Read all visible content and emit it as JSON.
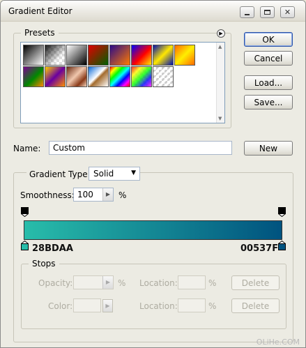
{
  "window": {
    "title": "Gradient Editor"
  },
  "presets": {
    "label": "Presets",
    "swatches": [
      "black-white",
      "transparent-black",
      "black-white-2",
      "red-green",
      "violet-orange",
      "blue-red-yellow",
      "blue-yellow-blue",
      "orange-yellow-orange",
      "violet-green-orange",
      "yellow-violet-orange",
      "copper",
      "chrome",
      "spectrum",
      "transparent-rainbow",
      "transparent-stripes"
    ]
  },
  "buttons": {
    "ok": "OK",
    "cancel": "Cancel",
    "load": "Load...",
    "save": "Save...",
    "new": "New"
  },
  "name_field": {
    "label": "Name:",
    "value": "Custom"
  },
  "gradient": {
    "type_label": "Gradient Type:",
    "type_value": "Solid",
    "smoothness_label": "Smoothness:",
    "smoothness_value": "100",
    "smoothness_unit": "%",
    "left_color_hex": "28BDAA",
    "right_color_hex": "00537F",
    "left_color": "#28BDAA",
    "right_color": "#00537F"
  },
  "stops": {
    "label": "Stops",
    "opacity_label": "Opacity:",
    "opacity_unit": "%",
    "location_label_1": "Location:",
    "location_unit_1": "%",
    "delete_1": "Delete",
    "color_label": "Color:",
    "location_label_2": "Location:",
    "location_unit_2": "%",
    "delete_2": "Delete"
  },
  "watermark": "OLiHe.COM"
}
